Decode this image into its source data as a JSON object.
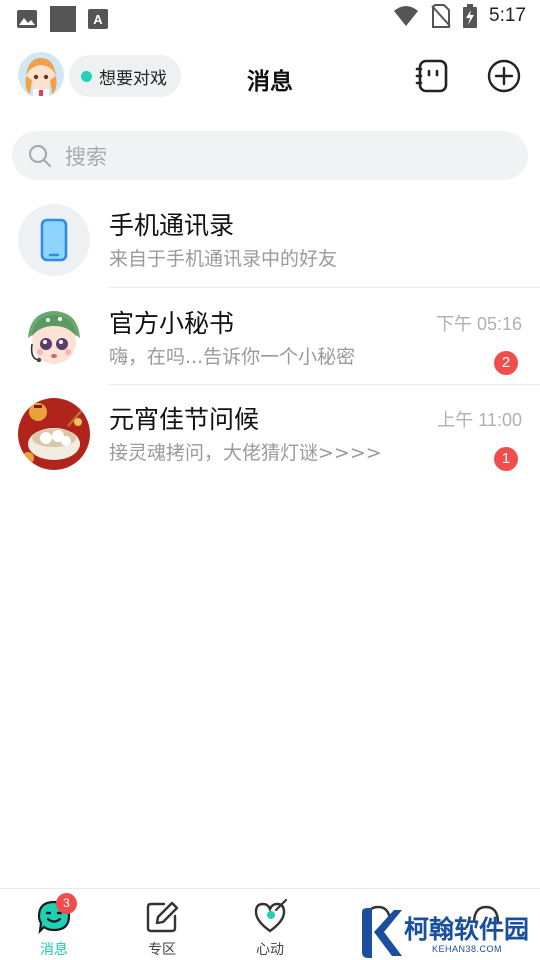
{
  "status_bar": {
    "time": "5:17",
    "left_icons": [
      "image-icon",
      "square-icon",
      "font-a-icon"
    ],
    "right_icons": [
      "wifi-icon",
      "sim-off-icon",
      "battery-charging-icon"
    ]
  },
  "header": {
    "title": "消息",
    "mood_label": "想要对戏",
    "mood_dot_color": "#1fd2b8",
    "icons": [
      "avatar",
      "contact-card-icon",
      "add-circle-icon"
    ]
  },
  "search": {
    "placeholder": "搜索"
  },
  "conversations": [
    {
      "name": "手机通讯录",
      "preview": "来自于手机通讯录中的好友",
      "time": "",
      "unread": "",
      "icon": "phone-icon"
    },
    {
      "name": "官方小秘书",
      "preview": "嗨，在吗...告诉你一个小秘密",
      "time": "下午 05:16",
      "unread": "2",
      "icon": "secretary-avatar"
    },
    {
      "name": "元宵佳节问候",
      "preview": "接灵魂拷问，大佬猜灯谜>>>>",
      "time": "上午 11:00",
      "unread": "1",
      "icon": "lantern-festival-avatar"
    }
  ],
  "bottom_nav": {
    "tabs": [
      {
        "label": "消息",
        "icon": "message-icon",
        "badge": "3",
        "active": true
      },
      {
        "label": "专区",
        "icon": "edit-icon",
        "badge": "",
        "active": false
      },
      {
        "label": "心动",
        "icon": "heart-icon",
        "badge": "",
        "active": false
      },
      {
        "label": "",
        "icon": "partial-icon",
        "badge": "",
        "active": false
      },
      {
        "label": "",
        "icon": "partial-icon",
        "badge": "",
        "active": false
      }
    ]
  },
  "watermark": {
    "title": "柯翰软件园",
    "subtitle": "KEHAN38.COM"
  },
  "colors": {
    "accent": "#18c9b0",
    "badge": "#f24d4d",
    "muted_text": "#9a9a9a"
  }
}
